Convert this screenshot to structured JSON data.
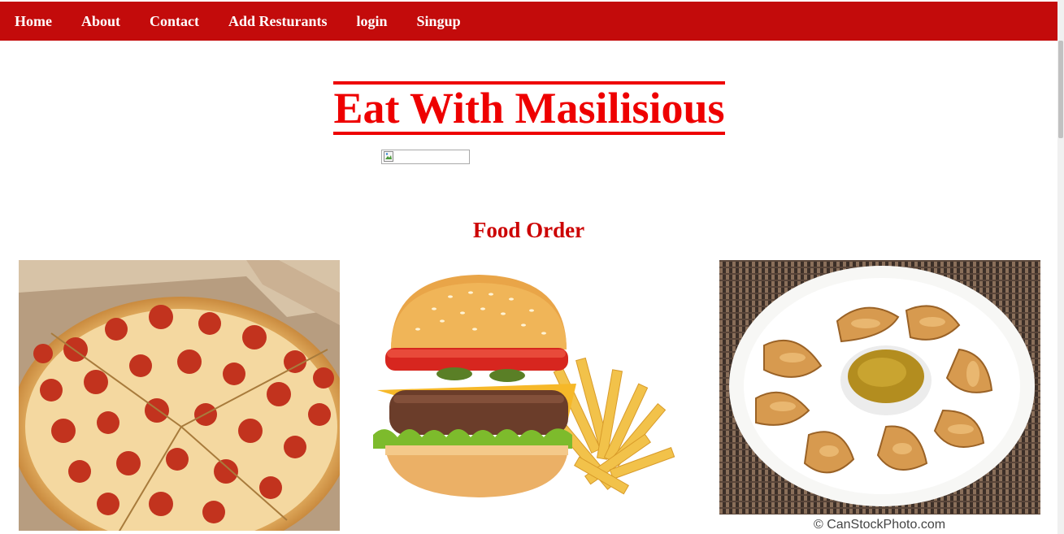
{
  "nav": {
    "items": [
      "Home",
      "About",
      "Contact",
      "Add Resturants",
      "login",
      "Singup"
    ]
  },
  "header": {
    "title": "Eat With Masilisious"
  },
  "section": {
    "title": "Food Order"
  },
  "food_items": [
    {
      "name": "pizza-image"
    },
    {
      "name": "burger-image"
    },
    {
      "name": "momos-image",
      "watermark": "© CanStockPhoto.com"
    }
  ],
  "colors": {
    "nav_bg": "#c30b0b",
    "title": "#ee0000",
    "section_title": "#cc0000"
  }
}
